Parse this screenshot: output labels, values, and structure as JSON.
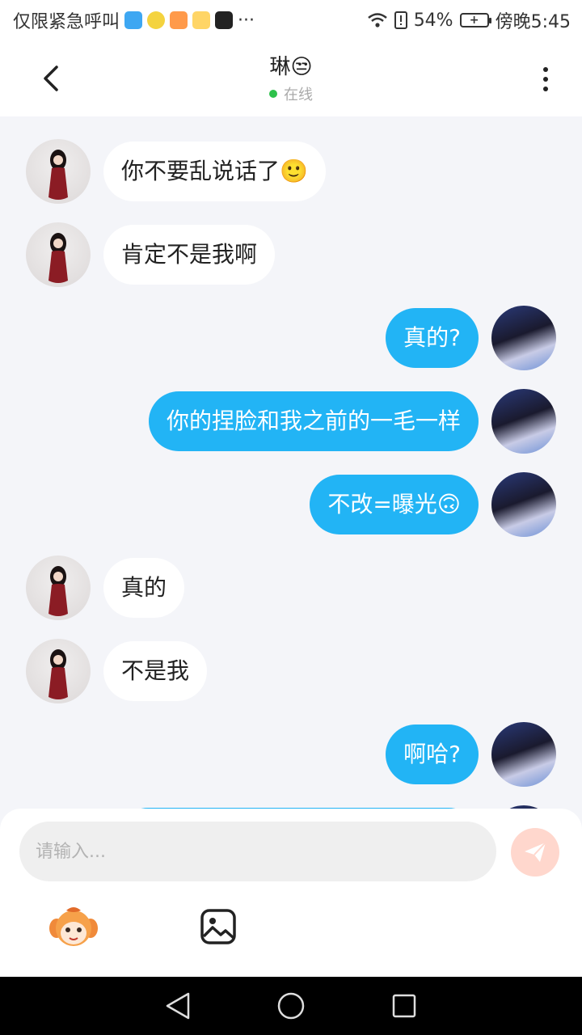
{
  "status_bar": {
    "carrier": "仅限紧急呼叫",
    "more": "···",
    "battery_pct": "54%",
    "time": "傍晚5:45"
  },
  "header": {
    "name": "琳😒",
    "online": "在线"
  },
  "messages": [
    {
      "side": "left",
      "text": "你不要乱说话了🙂"
    },
    {
      "side": "left",
      "text": "肯定不是我啊"
    },
    {
      "side": "right",
      "text": "真的?"
    },
    {
      "side": "right",
      "text": "你的捏脸和我之前的一毛一样"
    },
    {
      "side": "right",
      "text": "不改=曝光🙃"
    },
    {
      "side": "left",
      "text": "真的"
    },
    {
      "side": "left",
      "text": "不是我"
    },
    {
      "side": "right",
      "text": "啊哈?"
    }
  ],
  "input": {
    "placeholder": "请输入..."
  },
  "colors": {
    "accent_bubble": "#22b4f5",
    "online_dot": "#2ec14b",
    "send_button": "#ffd7cd"
  },
  "icons": [
    "back-icon",
    "more-icon",
    "send-icon",
    "mascot-icon",
    "image-icon",
    "nav-back-icon",
    "nav-home-icon",
    "nav-recents-icon"
  ]
}
